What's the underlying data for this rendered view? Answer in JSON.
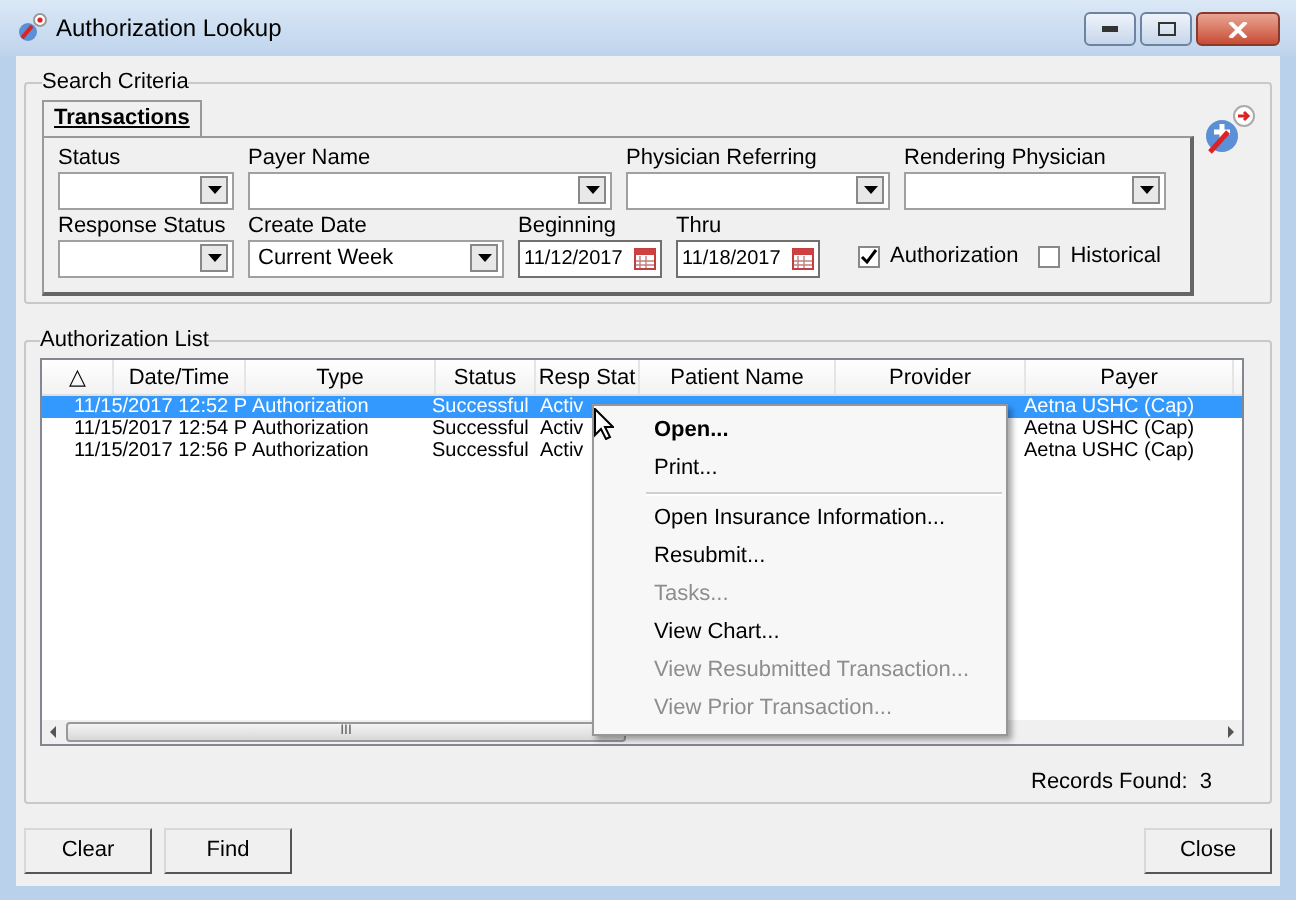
{
  "window": {
    "title": "Authorization Lookup"
  },
  "search_criteria": {
    "title": "Search Criteria",
    "tabs": [
      {
        "label": "Transactions",
        "selected": true
      }
    ],
    "fields": [
      {
        "kind": "combo",
        "label": "Status"
      },
      {
        "kind": "combo",
        "label": "Payer Name"
      },
      {
        "kind": "combo",
        "label": "Physician Referring"
      },
      {
        "kind": "combo",
        "label": "Rendering Physician"
      },
      {
        "kind": "combo",
        "label": "Response Status"
      },
      {
        "kind": "combo",
        "label": "Create Date",
        "value": "Current Week"
      },
      {
        "kind": "date",
        "label": "Beginning",
        "value": "11/12/2017"
      },
      {
        "kind": "date",
        "label": "Thru",
        "value": "11/18/2017"
      }
    ],
    "checkboxes": [
      {
        "label": "Authorization",
        "checked": true
      },
      {
        "label": "Historical",
        "checked": false
      }
    ]
  },
  "authorization_list": {
    "title": "Authorization List",
    "columns": [
      "△",
      "Date/Time",
      "Type",
      "Status",
      "Resp Stat",
      "Patient Name",
      "Provider",
      "Payer"
    ],
    "rows": [
      {
        "date_time": "11/15/2017 12:52 P",
        "type": "Authorization",
        "status": "Successful",
        "resp_stat": "Activ",
        "payer": "Aetna USHC (Cap)",
        "selected": true
      },
      {
        "date_time": "11/15/2017 12:54 P",
        "type": "Authorization",
        "status": "Successful",
        "resp_stat": "Activ",
        "payer": "Aetna USHC (Cap)",
        "selected": false
      },
      {
        "date_time": "11/15/2017 12:56 P",
        "type": "Authorization",
        "status": "Successful",
        "resp_stat": "Activ",
        "payer": "Aetna USHC (Cap)",
        "selected": false
      }
    ],
    "scroll_thumb": "III",
    "records_found": "Records Found:  3"
  },
  "context_menu": [
    {
      "kind": "item",
      "label": "Open...",
      "default": true,
      "disabled": false
    },
    {
      "kind": "item",
      "label": "Print...",
      "default": false,
      "disabled": false
    },
    {
      "kind": "separator"
    },
    {
      "kind": "item",
      "label": "Open Insurance Information...",
      "default": false,
      "disabled": false
    },
    {
      "kind": "item",
      "label": "Resubmit...",
      "default": false,
      "disabled": false
    },
    {
      "kind": "item",
      "label": "Tasks...",
      "default": false,
      "disabled": true
    },
    {
      "kind": "item",
      "label": "View Chart...",
      "default": false,
      "disabled": false
    },
    {
      "kind": "item",
      "label": "View Resubmitted Transaction...",
      "default": false,
      "disabled": true
    },
    {
      "kind": "item",
      "label": "View Prior Transaction...",
      "default": false,
      "disabled": true
    }
  ],
  "buttons": [
    "Clear",
    "Find",
    "Close"
  ]
}
